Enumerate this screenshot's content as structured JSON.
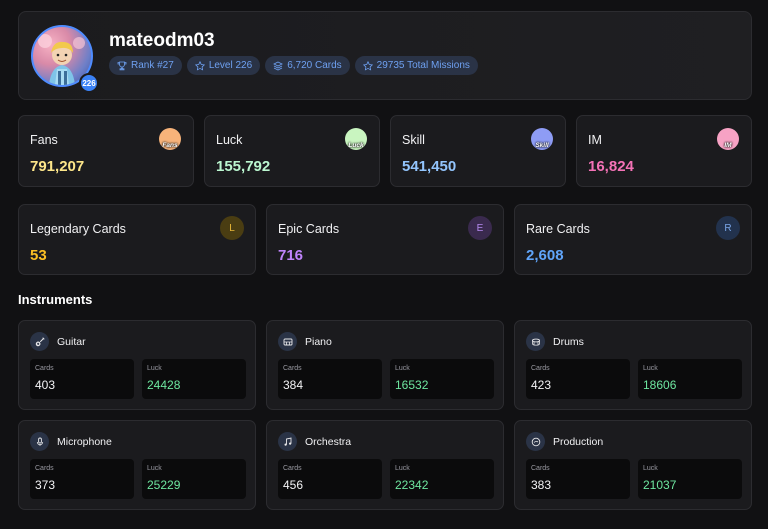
{
  "profile": {
    "username": "mateodm03",
    "level_badge": "226",
    "chips": [
      {
        "icon": "trophy-icon",
        "label": "Rank #27"
      },
      {
        "icon": "star-icon",
        "label": "Level 226"
      },
      {
        "icon": "layers-icon",
        "label": "6,720 Cards"
      },
      {
        "icon": "star-icon",
        "label": "29735 Total Missions"
      }
    ]
  },
  "stats": [
    {
      "label": "Fans",
      "value": "791,207",
      "value_color": "#fde68a",
      "icon_text": "Fans",
      "icon_color": "#f7b37a"
    },
    {
      "label": "Luck",
      "value": "155,792",
      "value_color": "#bbf7d0",
      "icon_text": "Luck",
      "icon_color": "#c9f5c0"
    },
    {
      "label": "Skill",
      "value": "541,450",
      "value_color": "#93c5fd",
      "icon_text": "Skill",
      "icon_color": "#8e9cf5"
    },
    {
      "label": "IM",
      "value": "16,824",
      "value_color": "#f472b6",
      "icon_text": "IM",
      "icon_color": "#f7a2c4"
    }
  ],
  "rarities": [
    {
      "label": "Legendary Cards",
      "value": "53",
      "letter": "L",
      "value_color": "#fbbf24",
      "badge_bg": "#4a3d12",
      "badge_fg": "#e7b637"
    },
    {
      "label": "Epic Cards",
      "value": "716",
      "letter": "E",
      "value_color": "#c084fc",
      "badge_bg": "#3a2a4e",
      "badge_fg": "#b58af0"
    },
    {
      "label": "Rare Cards",
      "value": "2,608",
      "letter": "R",
      "value_color": "#60a5fa",
      "badge_bg": "#22324d",
      "badge_fg": "#7aa6e8"
    }
  ],
  "instruments_title": "Instruments",
  "instruments": [
    {
      "name": "Guitar",
      "icon": "guitar-icon",
      "cards_label": "Cards",
      "cards": "403",
      "luck_label": "Luck",
      "luck": "24428"
    },
    {
      "name": "Piano",
      "icon": "piano-icon",
      "cards_label": "Cards",
      "cards": "384",
      "luck_label": "Luck",
      "luck": "16532"
    },
    {
      "name": "Drums",
      "icon": "drums-icon",
      "cards_label": "Cards",
      "cards": "423",
      "luck_label": "Luck",
      "luck": "18606"
    },
    {
      "name": "Microphone",
      "icon": "microphone-icon",
      "cards_label": "Cards",
      "cards": "373",
      "luck_label": "Luck",
      "luck": "25229"
    },
    {
      "name": "Orchestra",
      "icon": "music-note-icon",
      "cards_label": "Cards",
      "cards": "456",
      "luck_label": "Luck",
      "luck": "22342"
    },
    {
      "name": "Production",
      "icon": "disc-icon",
      "cards_label": "Cards",
      "cards": "383",
      "luck_label": "Luck",
      "luck": "21037"
    }
  ]
}
